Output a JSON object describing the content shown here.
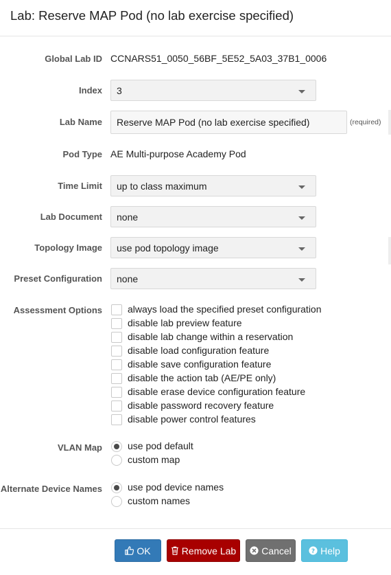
{
  "dialog": {
    "title": "Lab: Reserve MAP Pod (no lab exercise specified)"
  },
  "fields": {
    "global_lab_id": {
      "label": "Global Lab ID",
      "value": "CCNARS51_0050_56BF_5E52_5A03_37B1_0006"
    },
    "index": {
      "label": "Index",
      "value": "3"
    },
    "lab_name": {
      "label": "Lab Name",
      "value": "Reserve MAP Pod (no lab exercise specified)",
      "required_note": "(required)"
    },
    "pod_type": {
      "label": "Pod Type",
      "value": "AE Multi-purpose Academy Pod"
    },
    "time_limit": {
      "label": "Time Limit",
      "value": "up to class maximum"
    },
    "lab_document": {
      "label": "Lab Document",
      "value": "none"
    },
    "topology_image": {
      "label": "Topology Image",
      "value": "use pod topology image"
    },
    "preset_configuration": {
      "label": "Preset Configuration",
      "value": "none"
    }
  },
  "assessment": {
    "label": "Assessment Options",
    "options": [
      {
        "label": "always load the specified preset configuration",
        "checked": false
      },
      {
        "label": "disable lab preview feature",
        "checked": false
      },
      {
        "label": "disable lab change within a reservation",
        "checked": false
      },
      {
        "label": "disable load configuration feature",
        "checked": false
      },
      {
        "label": "disable save configuration feature",
        "checked": false
      },
      {
        "label": "disable the action tab (AE/PE only)",
        "checked": false
      },
      {
        "label": "disable erase device configuration feature",
        "checked": false
      },
      {
        "label": "disable password recovery feature",
        "checked": false
      },
      {
        "label": "disable power control features",
        "checked": false
      }
    ]
  },
  "vlan_map": {
    "label": "VLAN Map",
    "options": [
      {
        "label": "use pod default",
        "selected": true
      },
      {
        "label": "custom map",
        "selected": false
      }
    ]
  },
  "device_names": {
    "label": "Alternate Device Names",
    "options": [
      {
        "label": "use pod device names",
        "selected": true
      },
      {
        "label": "custom names",
        "selected": false
      }
    ]
  },
  "buttons": {
    "ok": "OK",
    "remove": "Remove Lab",
    "cancel": "Cancel",
    "help": "Help"
  },
  "icons": {
    "ok": "thumbs-up-icon",
    "remove": "trash-icon",
    "cancel": "times-circle-icon",
    "help": "question-circle-icon",
    "select": "caret-down-icon"
  },
  "colors": {
    "ok": "#337ab7",
    "remove": "#a80000",
    "cancel": "#707070",
    "help": "#5bc0de",
    "label": "#555555"
  }
}
